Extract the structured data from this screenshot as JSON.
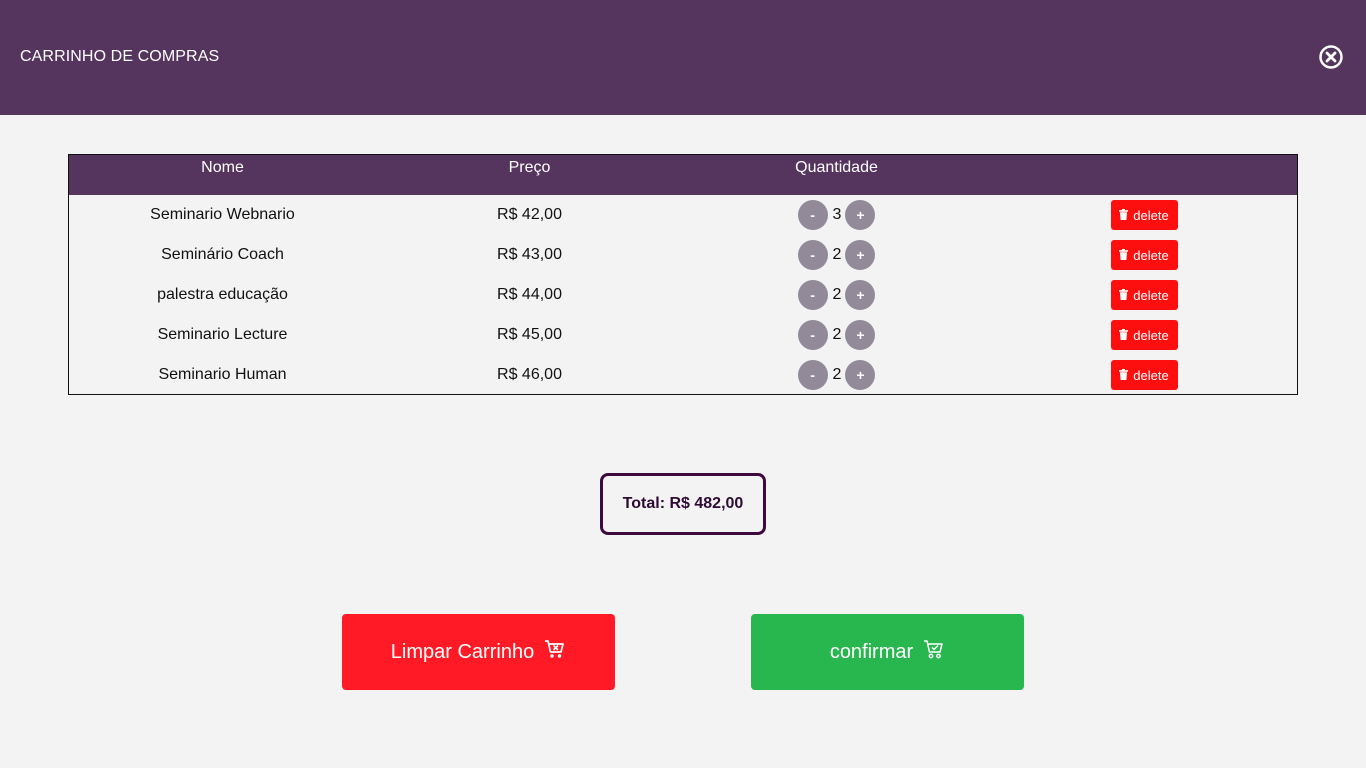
{
  "header": {
    "title": "CARRINHO DE COMPRAS",
    "close_icon": "close-circle-icon"
  },
  "table": {
    "columns": [
      "Nome",
      "Preço",
      "Quantidade"
    ],
    "rows": [
      {
        "name": "Seminario Webnario",
        "price": "R$ 42,00",
        "qty": "3",
        "minus": "-",
        "plus": "+",
        "delete": "delete"
      },
      {
        "name": "Seminário Coach",
        "price": "R$ 43,00",
        "qty": "2",
        "minus": "-",
        "plus": "+",
        "delete": "delete"
      },
      {
        "name": "palestra educação",
        "price": "R$ 44,00",
        "qty": "2",
        "minus": "-",
        "plus": "+",
        "delete": "delete"
      },
      {
        "name": "Seminario Lecture",
        "price": "R$ 45,00",
        "qty": "2",
        "minus": "-",
        "plus": "+",
        "delete": "delete"
      },
      {
        "name": "Seminario Human",
        "price": "R$ 46,00",
        "qty": "2",
        "minus": "-",
        "plus": "+",
        "delete": "delete"
      }
    ]
  },
  "total": {
    "text": "Total: R$ 482,00"
  },
  "actions": {
    "clear_label": "Limpar Carrinho",
    "clear_icon": "cart-remove-icon",
    "confirm_label": "confirmar",
    "confirm_icon": "cart-check-icon"
  },
  "colors": {
    "header_bg": "#55355e",
    "delete": "#fe0f0f",
    "clear": "#ff1a26",
    "confirm": "#28b74e",
    "qty_button": "#928a98"
  }
}
